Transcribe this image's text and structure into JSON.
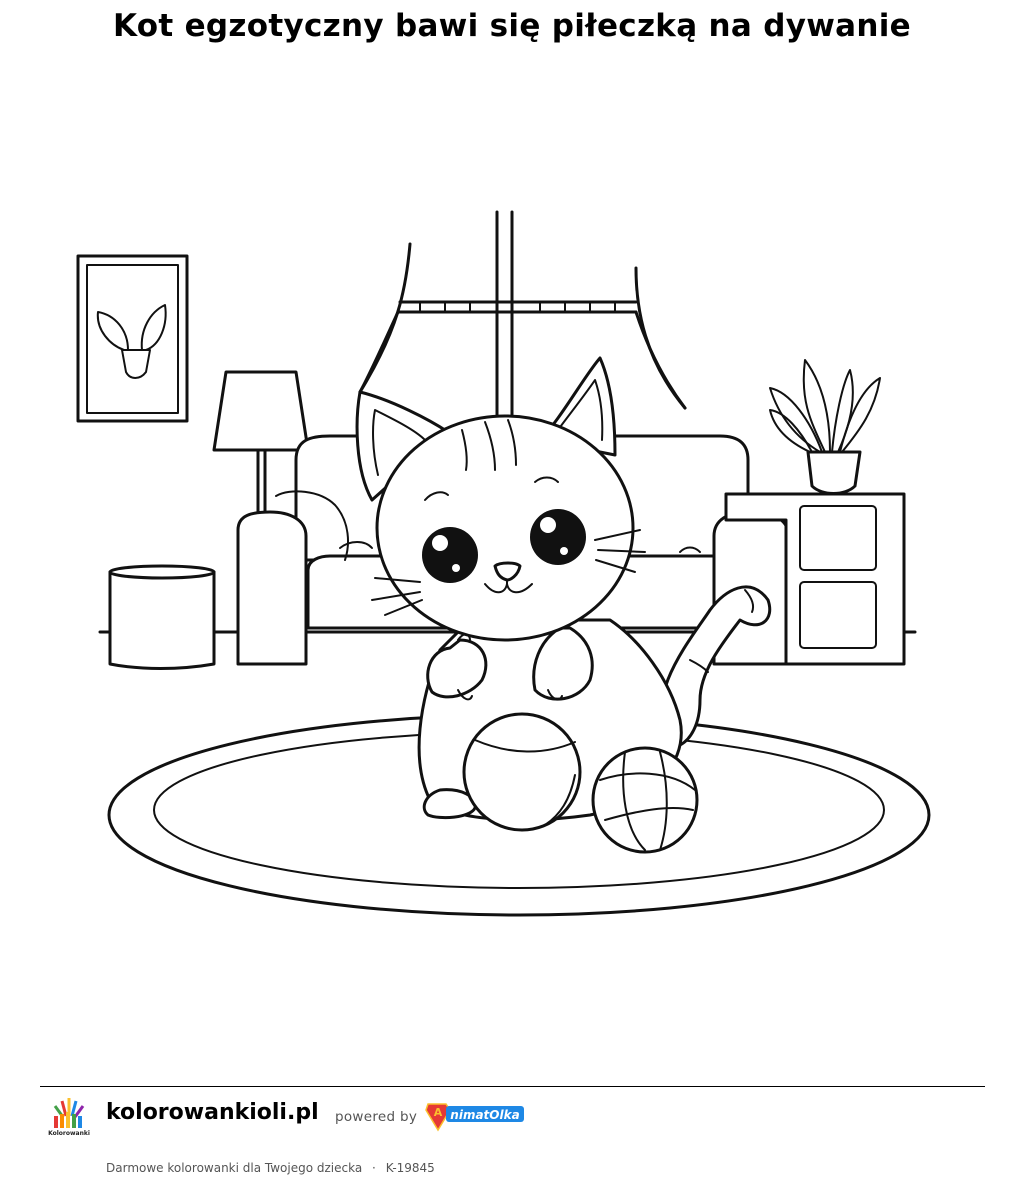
{
  "title": "Kot egzotyczny bawi się piłeczką na dywanie",
  "footer": {
    "site_name": "kolorowankioli.pl",
    "powered_by": "powered by",
    "brand": "AnimatOlka",
    "logo_text": "Kolorowanki Oli",
    "tagline": "Darmowe kolorowanki dla Twojego dziecka",
    "separator": "·",
    "code": "K-19845"
  },
  "colors": {
    "brand_blue": "#1e88e5",
    "brand_red": "#e53935",
    "brand_yellow": "#fbc02d"
  },
  "icons": [
    "kolorowanki-logo",
    "animatolka-logo"
  ]
}
